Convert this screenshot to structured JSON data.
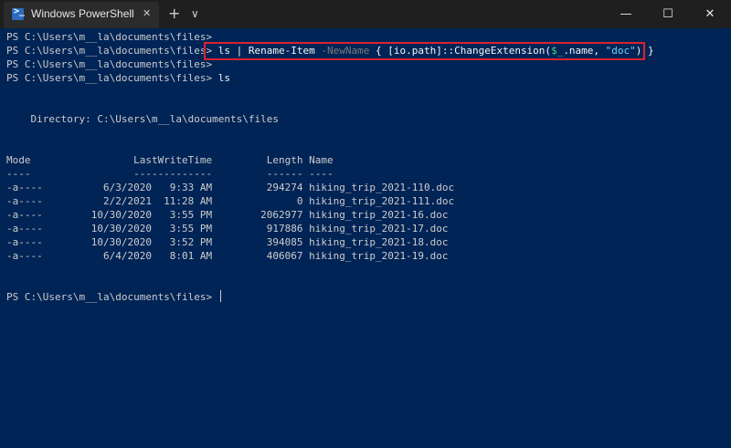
{
  "window": {
    "tab_title": "Windows PowerShell",
    "tab_icon_glyph": ">_",
    "close_tab_glyph": "✕",
    "new_tab_glyph": "+",
    "dropdown_glyph": "∨",
    "minimize_glyph": "—",
    "maximize_glyph": "☐",
    "close_glyph": "✕"
  },
  "terminal": {
    "prompt": "PS C:\\Users\\m__la\\documents\\files> ",
    "command": {
      "part1": "ls | Rename-Item ",
      "param": "-NewName",
      "part2": " { [io.path]::ChangeExtension(",
      "var": "$_",
      "part3": ".name, ",
      "str": "\"doc\"",
      "part4": ") }"
    },
    "ls_command": "ls",
    "directory_line": "    Directory: C:\\Users\\m__la\\documents\\files",
    "header_line": "Mode                 LastWriteTime         Length Name",
    "separator_line": "----                 -------------         ------ ----",
    "rows": [
      "-a----          6/3/2020   9:33 AM         294274 hiking_trip_2021-110.doc",
      "-a----          2/2/2021  11:28 AM              0 hiking_trip_2021-111.doc",
      "-a----        10/30/2020   3:55 PM        2062977 hiking_trip_2021-16.doc",
      "-a----        10/30/2020   3:55 PM         917886 hiking_trip_2021-17.doc",
      "-a----        10/30/2020   3:52 PM         394085 hiking_trip_2021-18.doc",
      "-a----          6/4/2020   8:01 AM         406067 hiking_trip_2021-19.doc"
    ]
  },
  "colors": {
    "background": "#012456",
    "titlebar": "#1f1f1f",
    "highlight_border": "#d9232e"
  }
}
